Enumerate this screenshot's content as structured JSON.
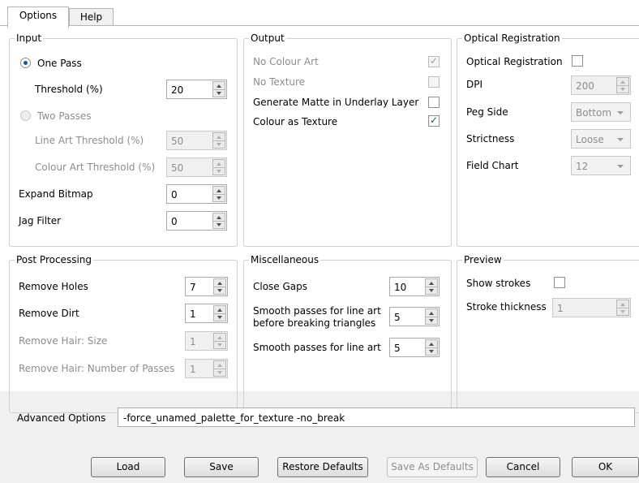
{
  "tabs": [
    {
      "label": "Options",
      "active": true
    },
    {
      "label": "Help",
      "active": false
    }
  ],
  "input": {
    "title": "Input",
    "one_pass": "One Pass",
    "threshold_label": "Threshold (%)",
    "threshold_value": "20",
    "two_passes": "Two Passes",
    "line_art_threshold_label": "Line Art Threshold (%)",
    "line_art_threshold_value": "50",
    "colour_art_threshold_label": "Colour Art Threshold (%)",
    "colour_art_threshold_value": "50",
    "expand_bitmap_label": "Expand Bitmap",
    "expand_bitmap_value": "0",
    "jag_filter_label": "Jag Filter",
    "jag_filter_value": "0"
  },
  "output": {
    "title": "Output",
    "no_colour_art": "No Colour Art",
    "no_colour_art_checked": true,
    "no_texture": "No Texture",
    "no_texture_checked": false,
    "generate_matte": "Generate Matte in Underlay Layer",
    "generate_matte_checked": false,
    "colour_as_texture": "Colour as Texture",
    "colour_as_texture_checked": true
  },
  "optical": {
    "title": "Optical Registration",
    "optical_registration": "Optical Registration",
    "optical_registration_checked": false,
    "dpi_label": "DPI",
    "dpi_value": "200",
    "peg_side_label": "Peg Side",
    "peg_side_value": "Bottom",
    "strictness_label": "Strictness",
    "strictness_value": "Loose",
    "field_chart_label": "Field Chart",
    "field_chart_value": "12"
  },
  "post": {
    "title": "Post Processing",
    "remove_holes_label": "Remove Holes",
    "remove_holes_value": "7",
    "remove_dirt_label": "Remove Dirt",
    "remove_dirt_value": "1",
    "remove_hair_size_label": "Remove Hair: Size",
    "remove_hair_size_value": "1",
    "remove_hair_passes_label": "Remove Hair: Number of Passes",
    "remove_hair_passes_value": "1"
  },
  "misc": {
    "title": "Miscellaneous",
    "close_gaps_label": "Close Gaps",
    "close_gaps_value": "10",
    "smooth_before_label_1": "Smooth passes for line art",
    "smooth_before_label_2": "before breaking triangles",
    "smooth_before_value": "5",
    "smooth_line_art_label": "Smooth passes for line art",
    "smooth_line_art_value": "5"
  },
  "preview": {
    "title": "Preview",
    "show_strokes": "Show strokes",
    "show_strokes_checked": false,
    "stroke_thickness_label": "Stroke thickness",
    "stroke_thickness_value": "1"
  },
  "advanced": {
    "label": "Advanced Options",
    "value": "-force_unamed_palette_for_texture -no_break"
  },
  "buttons": {
    "load": "Load",
    "save": "Save",
    "restore_defaults": "Restore Defaults",
    "save_as_defaults": "Save As Defaults",
    "cancel": "Cancel",
    "ok": "OK"
  },
  "icons": {
    "check": "✓"
  }
}
